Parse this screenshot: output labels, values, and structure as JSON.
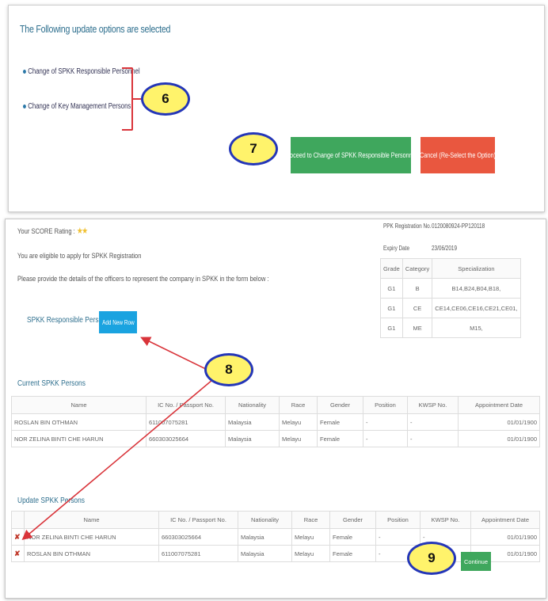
{
  "top_panel": {
    "title": "The Following update options are selected",
    "options": [
      "Change of SPKK Responsible Personnel",
      "Change of Key Management Persons"
    ],
    "proceed_button": "Proceed to Change of SPKK Responsible Personnel",
    "cancel_button": "Cancel (Re-Select the Option)"
  },
  "callouts": {
    "c6": "6",
    "c7": "7",
    "c8": "8",
    "c9": "9"
  },
  "bottom_panel": {
    "score_label": "Your SCORE Rating :",
    "score_stars": "★★",
    "eligible_text": "You are eligible to apply for SPKK Registration",
    "instruction_text": "Please provide the details of the officers to represent the company in SPKK in the form below :",
    "ppk_label": "PPK Registration No.",
    "ppk_value": "0120080924-PP120118",
    "expiry_label": "Expiry Date",
    "expiry_value": "23/06/2019",
    "responsible_label": "SPKK Responsible Persons",
    "add_row_button": "Add New Row",
    "grade_table": {
      "headers": [
        "Grade",
        "Category",
        "Specialization"
      ],
      "rows": [
        [
          "G1",
          "B",
          "B14,B24,B04,B18,"
        ],
        [
          "G1",
          "CE",
          "CE14,CE06,CE16,CE21,CE01,"
        ],
        [
          "G1",
          "ME",
          "M15,"
        ]
      ]
    },
    "current_title": "Current SPKK Persons",
    "update_title": "Update SPKK Persons",
    "person_headers": [
      "Name",
      "IC No. / Passport No.",
      "Nationality",
      "Race",
      "Gender",
      "Position",
      "KWSP No.",
      "Appointment Date"
    ],
    "current_rows": [
      [
        "ROSLAN BIN OTHMAN",
        "611007075281",
        "Malaysia",
        "Melayu",
        "Female",
        "-",
        "-",
        "01/01/1900"
      ],
      [
        "NOR ZELINA BINTI CHE HARUN",
        "660303025664",
        "Malaysia",
        "Melayu",
        "Female",
        "-",
        "-",
        "01/01/1900"
      ]
    ],
    "update_rows": [
      [
        "NOR ZELINA BINTI CHE HARUN",
        "660303025664",
        "Malaysia",
        "Melayu",
        "Female",
        "-",
        "-",
        "01/01/1900"
      ],
      [
        "ROSLAN BIN OTHMAN",
        "611007075281",
        "Malaysia",
        "Melayu",
        "Female",
        "-",
        "-",
        "01/01/1900"
      ]
    ],
    "delete_mark": "✘",
    "continue_button": "Continue"
  }
}
